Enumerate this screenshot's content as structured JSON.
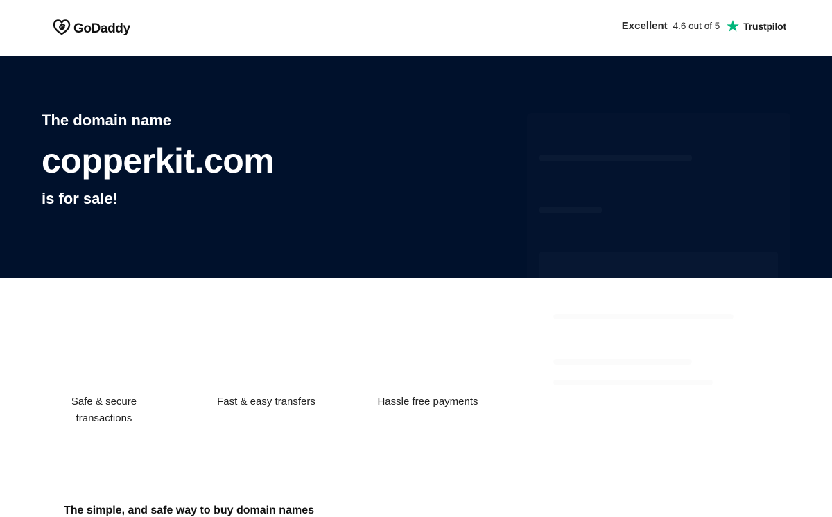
{
  "header": {
    "logo_text": "GoDaddy",
    "logo_icon": "godaddy-heart-logo",
    "trustpilot": {
      "label": "Excellent",
      "score_text": "4.6 out of 5",
      "star_icon": "trustpilot-star-icon",
      "star_color": "#00b67a",
      "brand": "Trustpilot"
    }
  },
  "hero": {
    "pretitle": "The domain name",
    "domain": "copperkit.com",
    "posttitle": "is for sale!",
    "background": "#00112c"
  },
  "features": [
    {
      "label": "Safe & secure transactions"
    },
    {
      "label": "Fast & easy transfers"
    },
    {
      "label": "Hassle free payments"
    }
  ],
  "tagline": "The simple, and safe way to buy domain names"
}
